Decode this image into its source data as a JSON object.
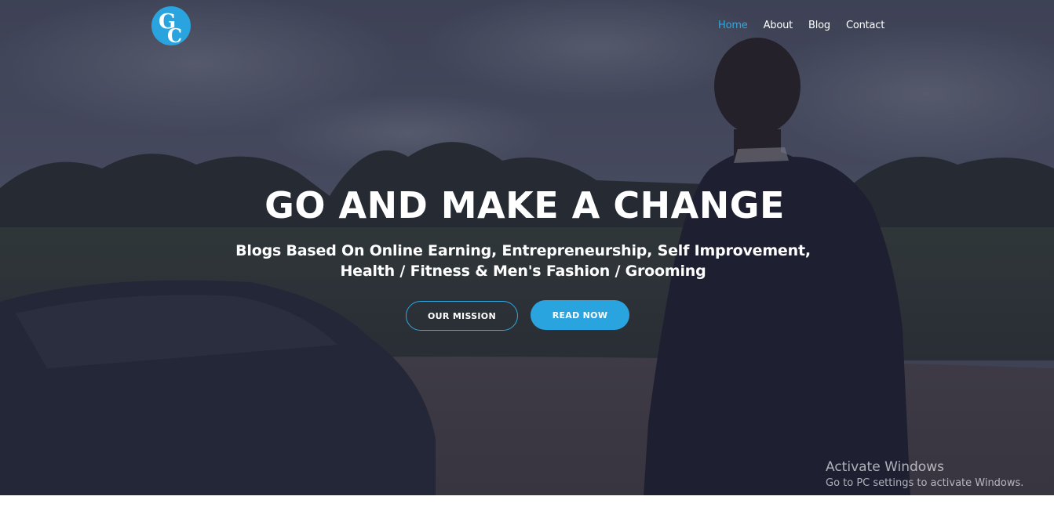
{
  "brand": {
    "logo_icon": "gc-logo-icon",
    "accent_color": "#2aa4df"
  },
  "nav": {
    "items": [
      {
        "label": "Home",
        "active": true
      },
      {
        "label": "About",
        "active": false
      },
      {
        "label": "Blog",
        "active": false
      },
      {
        "label": "Contact",
        "active": false
      }
    ]
  },
  "hero": {
    "title": "GO AND MAKE A CHANGE",
    "subtitle_line1": "Blogs Based On Online Earning, Entrepreneurship, Self Improvement,",
    "subtitle_line2": "Health / Fitness & Men's Fashion / Grooming",
    "buttons": {
      "mission": "OUR MISSION",
      "read": "READ NOW"
    }
  },
  "watermark": {
    "title": "Activate Windows",
    "subtitle": "Go to PC settings to activate Windows."
  }
}
